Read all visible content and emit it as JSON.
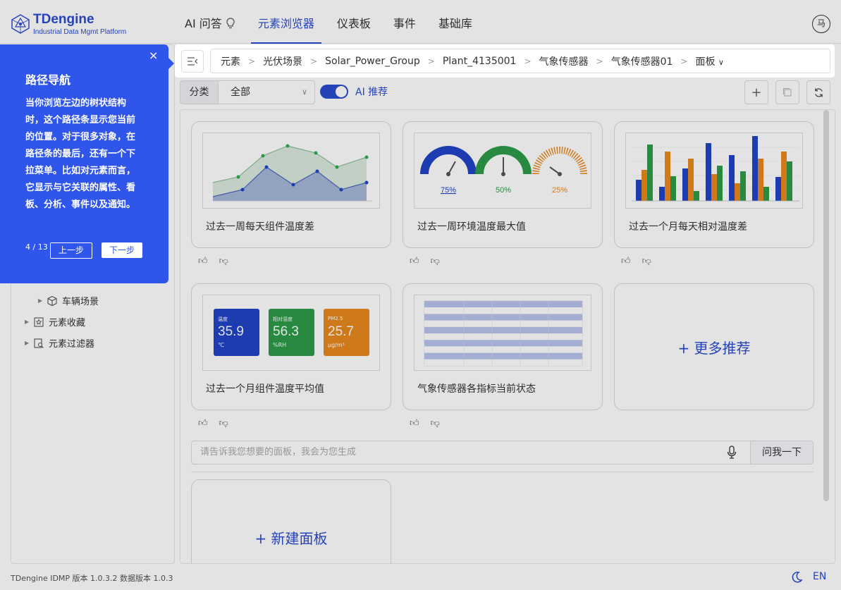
{
  "header": {
    "logo_title": "TDengine",
    "logo_subtitle": "Industrial Data Mgmt Platform",
    "nav": [
      "AI 问答",
      "元素浏览器",
      "仪表板",
      "事件",
      "基础库"
    ],
    "active_nav": "元素浏览器",
    "user_avatar": "马"
  },
  "breadcrumb": [
    "元素",
    "光伏场景",
    "Solar_Power_Group",
    "Plant_4135001",
    "气象传感器",
    "气象传感器01",
    "面板"
  ],
  "sidebar": {
    "items": [
      {
        "label": "车辆场景",
        "icon": "cube-icon"
      },
      {
        "label": "元素收藏",
        "icon": "favorites-icon"
      },
      {
        "label": "元素过滤器",
        "icon": "filter-icon"
      }
    ]
  },
  "filter": {
    "category_label": "分类",
    "category_value": "全部",
    "ai_recommend_label": "AI 推荐",
    "ai_recommend_on": true
  },
  "cards": [
    {
      "title": "过去一周每天组件温度差",
      "thumb": "area-line-chart"
    },
    {
      "title": "过去一周环境温度最大值",
      "thumb": "gauges",
      "gauges": [
        "75%",
        "50%",
        "25%"
      ]
    },
    {
      "title": "过去一个月每天相对温度差",
      "thumb": "bar-chart"
    },
    {
      "title": "过去一个月组件温度平均值",
      "thumb": "stat-tiles",
      "tiles": [
        {
          "label": "温度",
          "value": "35.9",
          "unit": "℃",
          "color": "#2244c8"
        },
        {
          "label": "相对湿度",
          "value": "56.3",
          "unit": "%RH",
          "color": "#2d9b4a"
        },
        {
          "label": "PM2.5",
          "value": "25.7",
          "unit": "μg/m³",
          "color": "#e88a1f"
        }
      ]
    },
    {
      "title": "气象传感器各指标当前状态",
      "thumb": "table"
    }
  ],
  "more_recommend": "+ 更多推荐",
  "ask": {
    "placeholder": "请告诉我您想要的面板，我会为您生成",
    "button": "问我一下"
  },
  "new_panel": "+ 新建面板",
  "footer": {
    "version": "TDengine IDMP 版本 1.0.3.2 数据版本 1.0.3",
    "lang": "EN"
  },
  "tour": {
    "title": "路径导航",
    "body": "当你浏览左边的树状结构时，这个路径条显示您当前的位置。对于很多对象，在路径条的最后，还有一个下拉菜单。比如对元素而言，它显示与它关联的属性、看板、分析、事件以及通知。",
    "step": "4 / 13",
    "prev": "上一步",
    "next": "下一步",
    "close": "×"
  },
  "colors": {
    "brand": "#2b4bd0",
    "tour_bg": "#2f55ea"
  }
}
